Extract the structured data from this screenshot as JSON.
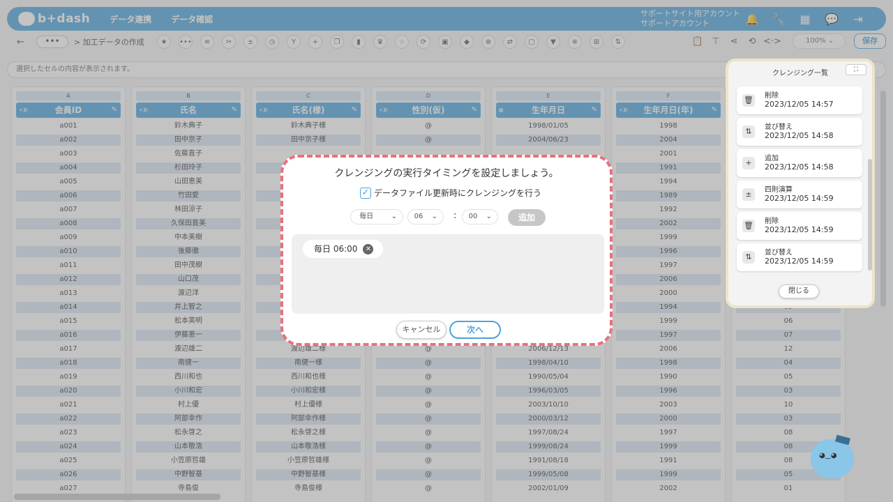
{
  "header": {
    "logo_text": "b+dash",
    "nav": [
      "データ連携",
      "データ確認"
    ],
    "account_line1": "サポートサイト用アカウント",
    "account_line2": "サポートアカウント",
    "icons": [
      "bell-icon",
      "wrench-icon",
      "grid-icon",
      "chat-icon",
      "logout-icon"
    ]
  },
  "toolbar": {
    "back": "←",
    "more": "•••",
    "breadcrumb": "> 加工データの作成",
    "zoom": "100%",
    "save": "保存"
  },
  "cell_bar": {
    "placeholder": "選択したセルの内容が表示されます。"
  },
  "grid": {
    "columns": [
      {
        "letter": "A",
        "name": "会員ID",
        "type": "+あ",
        "values": [
          "a001",
          "a002",
          "a003",
          "a004",
          "a005",
          "a006",
          "a007",
          "a008",
          "a009",
          "a010",
          "a011",
          "a012",
          "a013",
          "a014",
          "a015",
          "a016",
          "a017",
          "a018",
          "a019",
          "a020",
          "a021",
          "a022",
          "a023",
          "a024",
          "a025",
          "a026",
          "a027"
        ]
      },
      {
        "letter": "B",
        "name": "氏名",
        "type": "+あ",
        "values": [
          "鈴木典子",
          "田中京子",
          "佐藤直子",
          "杉田玲子",
          "山田恵美",
          "竹田愛",
          "林田涼子",
          "久保田直美",
          "中本美樹",
          "後藤徹",
          "田中茂樹",
          "山口茂",
          "渡辺洋",
          "井上智之",
          "松本英明",
          "伊藤恵一",
          "渡辺雄二",
          "南健一",
          "西川和也",
          "小川和宏",
          "村上優",
          "阿部幸作",
          "松永啓之",
          "山本敬浩",
          "小笠原哲雄",
          "中野智基",
          "寺島俊"
        ]
      },
      {
        "letter": "C",
        "name": "氏名(様)",
        "type": "+あ",
        "values": [
          "鈴木典子様",
          "田中京子様",
          "",
          "",
          "",
          "",
          "",
          "",
          "",
          "",
          "",
          "",
          "",
          "",
          "",
          "",
          "渡辺雄二様",
          "南健一様",
          "西川和也様",
          "小川和宏様",
          "村上優様",
          "阿部幸作様",
          "松永啓之様",
          "山本敬浩様",
          "小笠原哲雄様",
          "中野智基様",
          "寺島俊様"
        ]
      },
      {
        "letter": "D",
        "name": "性別(仮)",
        "type": "+あ",
        "values": [
          "@",
          "@",
          "",
          "",
          "",
          "",
          "",
          "",
          "",
          "",
          "",
          "",
          "",
          "",
          "",
          "",
          "@",
          "@",
          "@",
          "@",
          "@",
          "@",
          "@",
          "@",
          "@",
          "@",
          "@"
        ]
      },
      {
        "letter": "E",
        "name": "生年月日",
        "type": "cal",
        "values": [
          "1998/01/05",
          "2004/06/23",
          "",
          "",
          "",
          "",
          "",
          "",
          "",
          "",
          "",
          "",
          "",
          "",
          "",
          "",
          "2006/12/13",
          "1998/04/10",
          "1990/05/04",
          "1996/03/05",
          "2003/10/10",
          "2000/03/12",
          "1997/08/24",
          "1999/08/24",
          "1991/08/18",
          "1999/05/08",
          "2002/01/09"
        ]
      },
      {
        "letter": "F",
        "name": "生年月日(年)",
        "type": "+あ",
        "values": [
          "1998",
          "2004",
          "2001",
          "1991",
          "1994",
          "1989",
          "1992",
          "2002",
          "1999",
          "1996",
          "1997",
          "2006",
          "2000",
          "1994",
          "1999",
          "1997",
          "2006",
          "1998",
          "1990",
          "1996",
          "2003",
          "2000",
          "1997",
          "1999",
          "1991",
          "1999",
          "2002"
        ]
      },
      {
        "letter": "G",
        "name": "",
        "type": "",
        "values": [
          "",
          "",
          "",
          "",
          "",
          "",
          "",
          "",
          "",
          "",
          "",
          "",
          "",
          "09",
          "06",
          "07",
          "12",
          "04",
          "05",
          "03",
          "10",
          "03",
          "08",
          "08",
          "08",
          "05",
          "01"
        ]
      }
    ]
  },
  "panel": {
    "title": "クレンジング一覧",
    "fullscreen": "⛶",
    "items": [
      {
        "icon": "trash-icon",
        "glyph": "🗑",
        "name": "削除",
        "time": "2023/12/05 14:57"
      },
      {
        "icon": "sort-icon",
        "glyph": "⇅",
        "name": "並び替え",
        "time": "2023/12/05 14:58"
      },
      {
        "icon": "plus-icon",
        "glyph": "+",
        "name": "追加",
        "time": "2023/12/05 14:58"
      },
      {
        "icon": "calc-icon",
        "glyph": "±",
        "name": "四則演算",
        "time": "2023/12/05 14:59"
      },
      {
        "icon": "trash-icon",
        "glyph": "🗑",
        "name": "削除",
        "time": "2023/12/05 14:59"
      },
      {
        "icon": "sort-icon",
        "glyph": "⇅",
        "name": "並び替え",
        "time": "2023/12/05 14:59"
      }
    ],
    "close": "閉じる"
  },
  "modal": {
    "title": "クレンジングの実行タイミングを設定しましょう。",
    "checkbox_label": "データファイル更新時にクレンジングを行う",
    "checkbox_checked": true,
    "frequency": "毎日",
    "hour": "06",
    "colon": ":",
    "minute": "00",
    "add": "追加",
    "chip": "毎日 06:00",
    "cancel": "キャンセル",
    "next": "次へ"
  },
  "colors": {
    "accent": "#4aa3dc",
    "modal_border": "#e8717e"
  }
}
